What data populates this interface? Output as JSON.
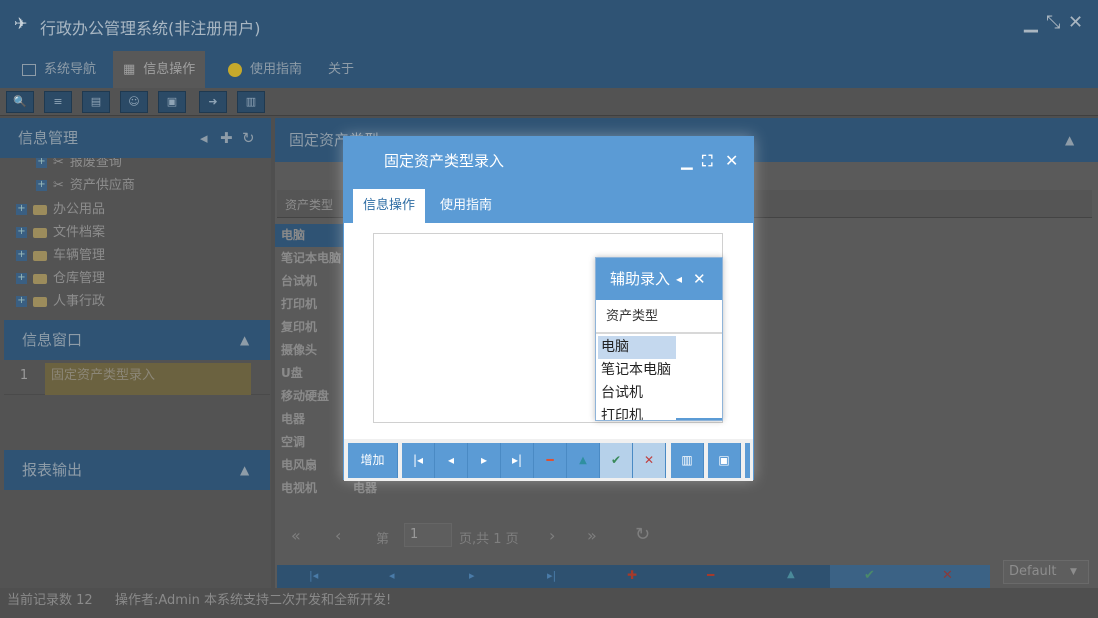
{
  "app": {
    "title": "行政办公管理系统(非注册用户)",
    "window_controls": {
      "minimize": "▁",
      "restore": "⤡",
      "close": "✕"
    }
  },
  "main_tabs": [
    {
      "label": "系统导航",
      "active": false
    },
    {
      "label": "信息操作",
      "active": true
    },
    {
      "label": "使用指南",
      "active": false
    },
    {
      "label": "关于",
      "active": false
    }
  ],
  "left": {
    "info_mgmt": {
      "title": "信息管理",
      "items": [
        {
          "label": "报废查询"
        },
        {
          "label": "资产供应商"
        },
        {
          "label": "办公用品"
        },
        {
          "label": "文件档案"
        },
        {
          "label": "车辆管理"
        },
        {
          "label": "仓库管理"
        },
        {
          "label": "人事行政"
        }
      ]
    },
    "info_window": {
      "title": "信息窗口",
      "rows": [
        {
          "num": "1",
          "label": "固定资产类型录入"
        }
      ]
    },
    "report": {
      "title": "报表输出"
    }
  },
  "right": {
    "title": "固定资产类型",
    "column": "资产类型",
    "rows": [
      "电脑",
      "笔记本电脑",
      "台试机",
      "打印机",
      "复印机",
      "摄像头",
      "U盘",
      "移动硬盘",
      "电器",
      "空调",
      "电风扇",
      "电视机"
    ],
    "last_row_extra": "电器",
    "pager": {
      "page_label": "第",
      "page": "1",
      "total": "页,共 1 页"
    },
    "theme_select": "Default"
  },
  "dialog": {
    "title": "固定资产类型录入",
    "tabs": [
      {
        "label": "信息操作"
      },
      {
        "label": "使用指南"
      }
    ],
    "add_label": "增加"
  },
  "popup": {
    "title": "辅助录入",
    "column": "资产类型",
    "items": [
      "电脑",
      "笔记本电脑",
      "台试机",
      "打印机"
    ]
  },
  "status": {
    "record_count": "当前记录数 12",
    "operator": "操作者:Admin",
    "notice": "本系统支持二次开发和全新开发!"
  },
  "colors": {
    "accent": "#5b9bd5",
    "dark_header": "#2f5374"
  }
}
